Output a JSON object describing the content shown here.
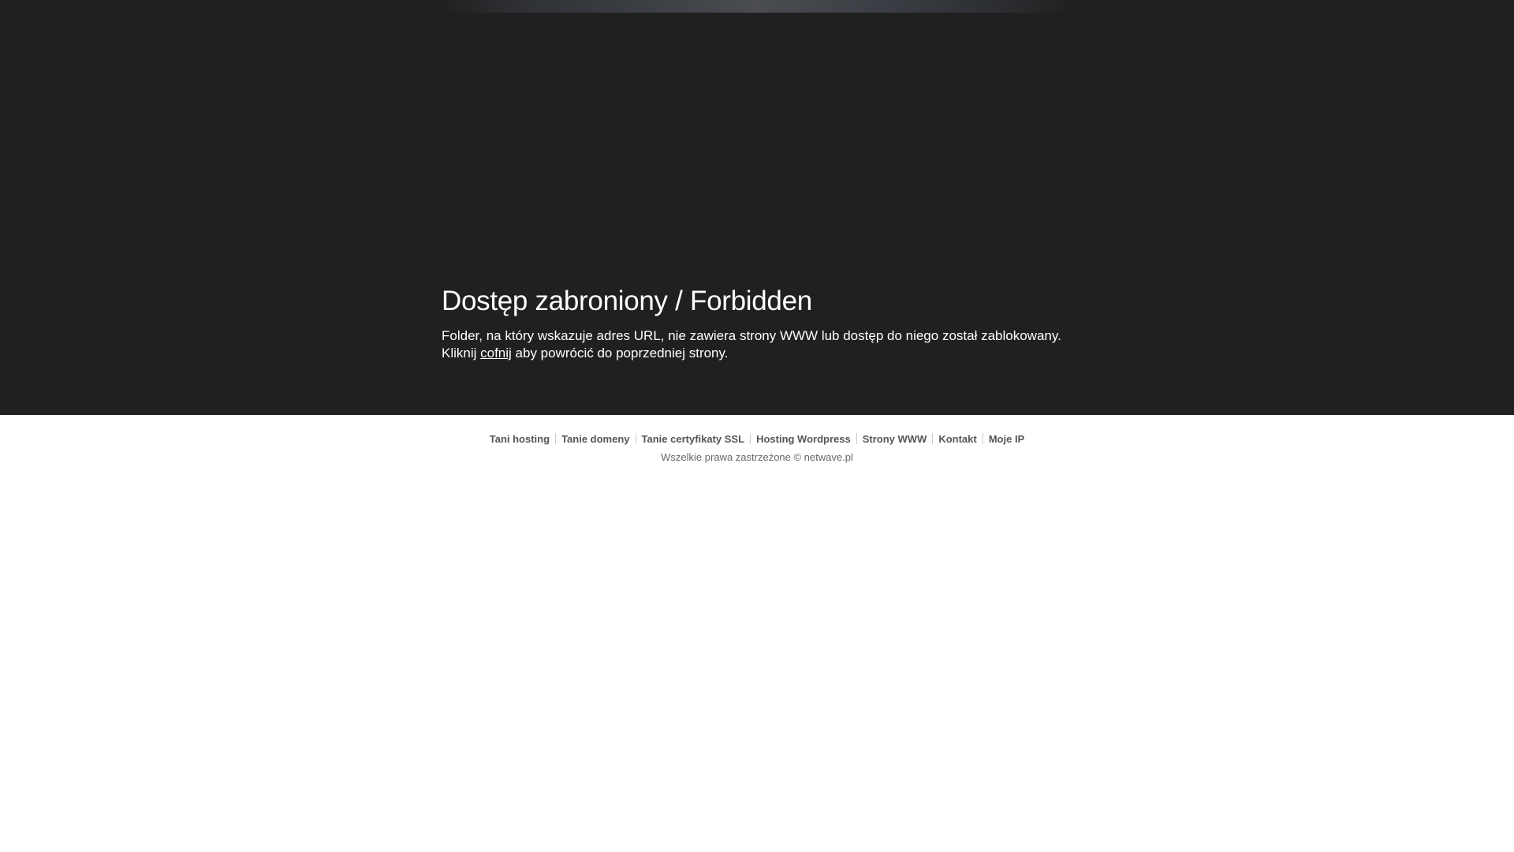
{
  "hero": {
    "title": "Dostęp zabroniony / Forbidden",
    "line1": "Folder, na który wskazuje adres URL, nie zawiera strony WWW lub dostęp do niego został zablokowany.",
    "line2_before": "Kliknij ",
    "line2_link": "cofnij",
    "line2_after": " aby powrócić do poprzedniej strony."
  },
  "footer": {
    "links": [
      "Tani hosting",
      "Tanie domeny",
      "Tanie certyfikaty SSL",
      "Hosting Wordpress",
      "Strony WWW",
      "Kontakt",
      "Moje IP"
    ],
    "copyright": "Wszelkie prawa zastrzeżone © netwave.pl"
  },
  "colors": {
    "hero_background": "#202020",
    "footer_link": "#555555",
    "copyright_text": "#666666"
  }
}
